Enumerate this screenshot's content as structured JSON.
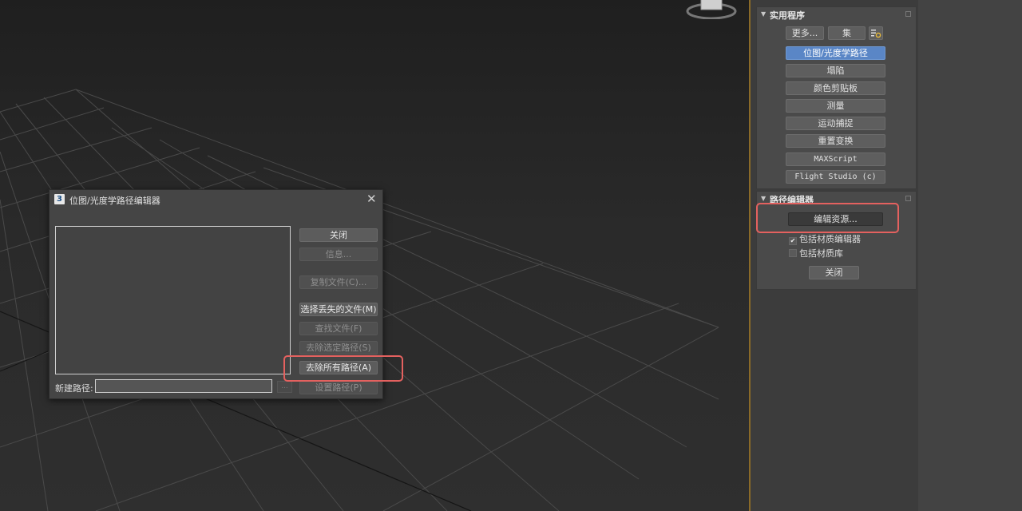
{
  "utilities": {
    "title": "实用程序",
    "more_label": "更多...",
    "sets_label": "集",
    "config_icon": "configure-sets-icon",
    "items": [
      {
        "label": "位图/光度学路径",
        "active": true
      },
      {
        "label": "塌陷",
        "active": false
      },
      {
        "label": "颜色剪贴板",
        "active": false
      },
      {
        "label": "测量",
        "active": false
      },
      {
        "label": "运动捕捉",
        "active": false
      },
      {
        "label": "重置变换",
        "active": false
      },
      {
        "label": "MAXScript",
        "active": false
      },
      {
        "label": "Flight Studio (c)",
        "active": false
      }
    ]
  },
  "path_editor": {
    "title": "路径编辑器",
    "edit_resources_label": "编辑资源...",
    "include_material_editor": {
      "label": "包括材质编辑器",
      "checked": true
    },
    "include_material_library": {
      "label": "包括材质库",
      "checked": false
    },
    "close_label": "关闭"
  },
  "dialog": {
    "title": "位图/光度学路径编辑器",
    "app_icon_text": "3",
    "new_path_label": "新建路径:",
    "new_path_value": "",
    "browse_label": "...",
    "buttons": {
      "close": {
        "label": "关闭",
        "enabled": true
      },
      "info": {
        "label": "信息...",
        "enabled": false
      },
      "copy_files": {
        "label": "复制文件(C)...",
        "enabled": false
      },
      "select_missing": {
        "label": "选择丢失的文件(M)",
        "enabled": true
      },
      "find_files": {
        "label": "查找文件(F)",
        "enabled": false
      },
      "strip_selected": {
        "label": "去除选定路径(S)",
        "enabled": false
      },
      "strip_all": {
        "label": "去除所有路径(A)",
        "enabled": true
      },
      "set_path": {
        "label": "设置路径(P)",
        "enabled": false
      }
    }
  },
  "colors": {
    "highlight": "#e4615f",
    "active_button": "#5a86c6",
    "viewport_border": "#8a6a28"
  }
}
